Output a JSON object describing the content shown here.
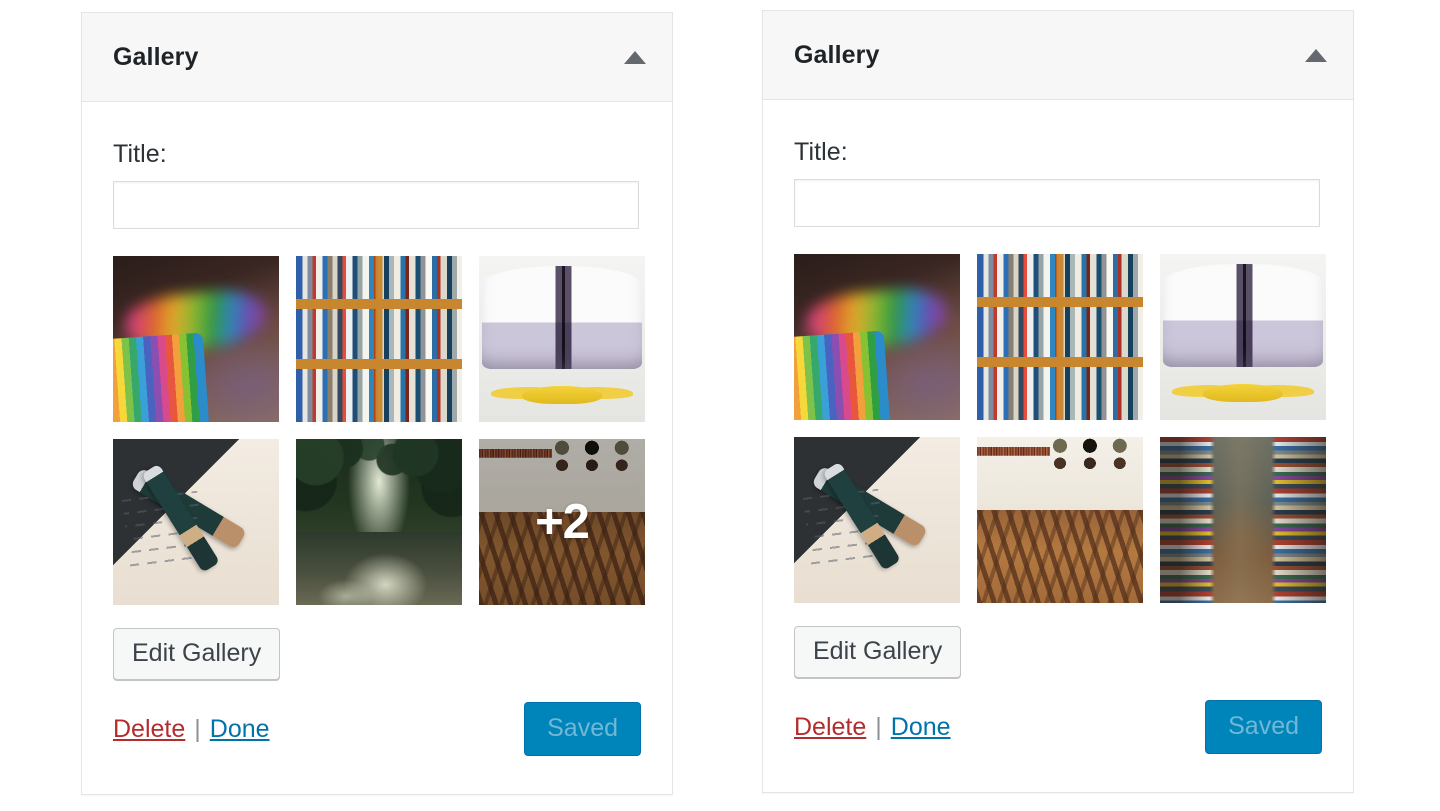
{
  "widgets": [
    {
      "id": "gallery-widget-left",
      "title": "Gallery",
      "toggle_icon": "triangle-up-icon",
      "field_label": "Title:",
      "title_value": "",
      "title_placeholder": "",
      "thumbnails": [
        {
          "name": "colored-pencils",
          "art": "art-pencils"
        },
        {
          "name": "bookshelf",
          "art": "art-shelf"
        },
        {
          "name": "open-book",
          "art": "art-openbook"
        },
        {
          "name": "fountain-pens",
          "art": "art-pen"
        },
        {
          "name": "forest-path",
          "art": "art-forest"
        },
        {
          "name": "library-reading-room",
          "art": "art-library"
        }
      ],
      "more_count_label": "+2",
      "has_more_overlay": true,
      "edit_label": "Edit Gallery",
      "delete_label": "Delete",
      "separator": "|",
      "done_label": "Done",
      "save_label": "Saved"
    },
    {
      "id": "gallery-widget-right",
      "title": "Gallery",
      "toggle_icon": "triangle-up-icon",
      "field_label": "Title:",
      "title_value": "",
      "title_placeholder": "",
      "thumbnails": [
        {
          "name": "colored-pencils",
          "art": "art-pencils"
        },
        {
          "name": "bookshelf",
          "art": "art-shelf"
        },
        {
          "name": "open-book",
          "art": "art-openbook"
        },
        {
          "name": "fountain-pens",
          "art": "art-pen"
        },
        {
          "name": "library-reading-room",
          "art": "art-library"
        },
        {
          "name": "bookstore-aisle",
          "art": "art-bookstore"
        }
      ],
      "more_count_label": "",
      "has_more_overlay": false,
      "edit_label": "Edit Gallery",
      "delete_label": "Delete",
      "separator": "|",
      "done_label": "Done",
      "save_label": "Saved"
    }
  ],
  "colors": {
    "page_background": "#ffffff",
    "panel_background": "#ffffff",
    "panel_border": "#e5e5e5",
    "header_background": "#f7f7f7",
    "title_text": "#1d2327",
    "toggle_icon": "#646970",
    "label_text": "#2c3338",
    "input_border": "#dcdcde",
    "secondary_button_background": "#f6f7f7",
    "secondary_button_border": "#c3c4c7",
    "secondary_button_text": "#3c434a",
    "delete_link": "#b32d2e",
    "done_link": "#0073aa",
    "separator": "#8c8f94",
    "saved_button_background": "#0085ba",
    "saved_button_border": "#0073aa",
    "saved_button_text": "#71b7d6",
    "overlay_text": "#ffffff",
    "overlay_scrim": "rgba(0,0,0,.28)"
  }
}
